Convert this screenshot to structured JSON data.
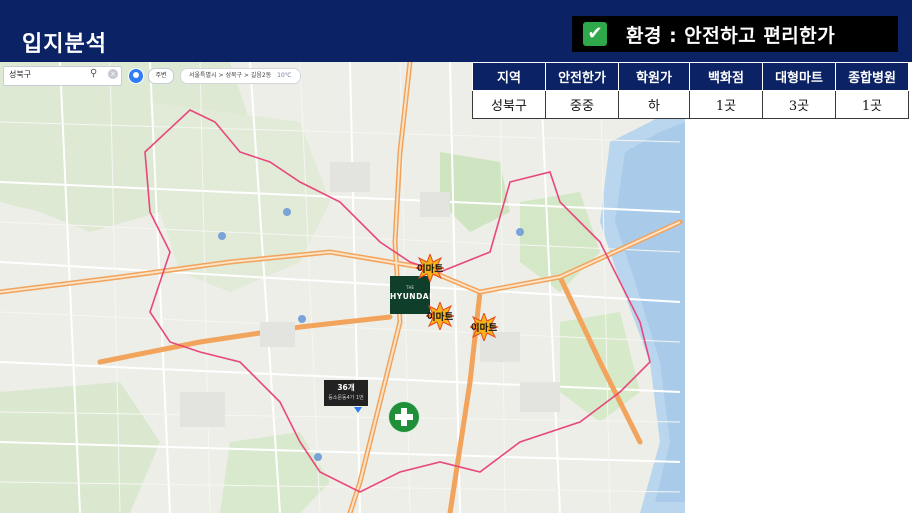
{
  "header": {
    "title": "입지분석",
    "badge_check": "✔",
    "badge_text": "환경 : 안전하고 편리한가"
  },
  "map": {
    "search_value": "성북구",
    "home_label": "주변",
    "breadcrumb": "서울특별시  >  성북구  >  길음2동",
    "temperature": "10℃",
    "hyundai_sub": "THE",
    "hyundai_name": "HYUNDAI",
    "emart_label": "이마트",
    "count_main": "36개",
    "count_sub": "등소문동4가 1번",
    "colors": {
      "boundary": "#e8477c",
      "main_road": "#f2a35c",
      "park": "#cfe5c1",
      "water": "#a9cbe9",
      "emart": "#f6b21b",
      "hospital": "#1f8f3a",
      "header": "#0b2265"
    }
  },
  "table": {
    "headers": [
      "지역",
      "안전한가",
      "학원가",
      "백화점",
      "대형마트",
      "종합병원"
    ],
    "rows": [
      [
        "성북구",
        "중중",
        "하",
        "1곳",
        "3곳",
        "1곳"
      ]
    ]
  }
}
